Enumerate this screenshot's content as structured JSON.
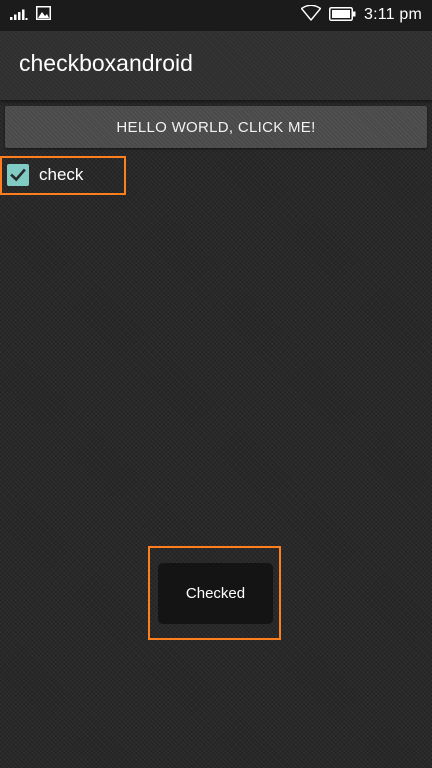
{
  "status_bar": {
    "time": "3:11 pm",
    "icons": [
      "signal-icon",
      "image-notification-icon",
      "wifi-icon",
      "battery-icon"
    ]
  },
  "action_bar": {
    "title": "checkboxandroid"
  },
  "main": {
    "button_label": "HELLO WORLD, CLICK ME!",
    "checkbox": {
      "label": "check",
      "checked": true
    }
  },
  "toast": {
    "message": "Checked"
  },
  "colors": {
    "checkbox_accent": "#80cbc4",
    "highlight_outline": "#ff7f1f",
    "background": "#282828"
  }
}
